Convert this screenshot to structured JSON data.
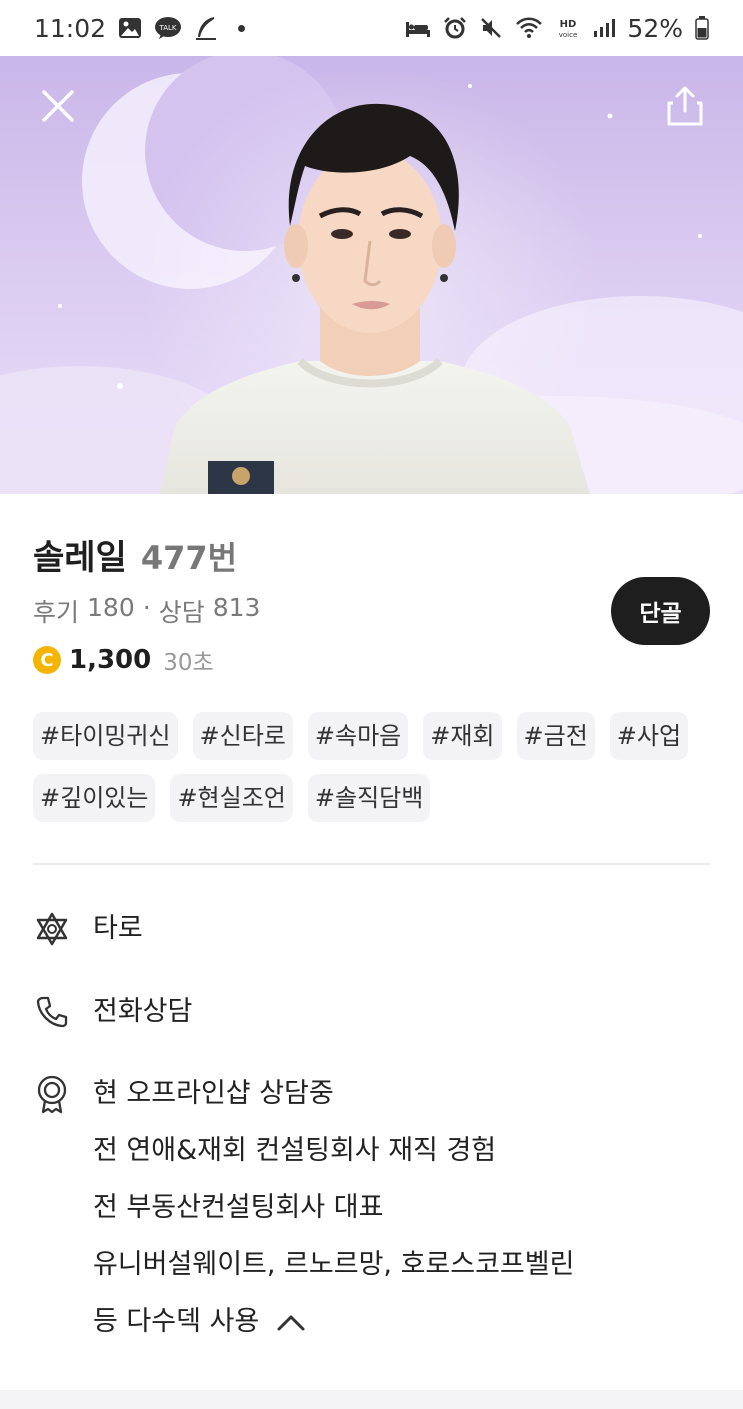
{
  "status_bar": {
    "time": "11:02",
    "battery": "52%",
    "icons": [
      "gallery-icon",
      "talk-icon",
      "feather-icon",
      "bed-icon",
      "alarm-icon",
      "mute-icon",
      "wifi-icon",
      "hd-voice-icon",
      "signal-icon",
      "battery-icon"
    ]
  },
  "hero": {
    "close_icon": "close-icon",
    "share_icon": "share-icon"
  },
  "profile": {
    "name": "솔레일",
    "number": "477번",
    "reviews_label": "후기",
    "reviews": "180",
    "separator": "·",
    "consult_label": "상담",
    "consults": "813",
    "coin_symbol": "C",
    "price": "1,300",
    "price_unit": "30초",
    "favorite_label": "단골"
  },
  "tags": [
    "#타이밍귀신",
    "#신타로",
    "#속마음",
    "#재회",
    "#금전",
    "#사업",
    "#깊이있는",
    "#현실조언",
    "#솔직담백"
  ],
  "details": {
    "category": "타로",
    "method": "전화상담",
    "career": [
      "현 오프라인샵 상담중",
      "전 연애&재회 컨설팅회사 재직 경험",
      "전 부동산컨설팅회사 대표",
      "유니버설웨이트, 르노르망, 호로스코프벨린",
      "등 다수덱 사용"
    ]
  },
  "colors": {
    "accent_dark": "#1e1e1e",
    "coin": "#f4b400",
    "tag_bg": "#f3f3f5",
    "hero_bg": "#d8c8ef"
  }
}
